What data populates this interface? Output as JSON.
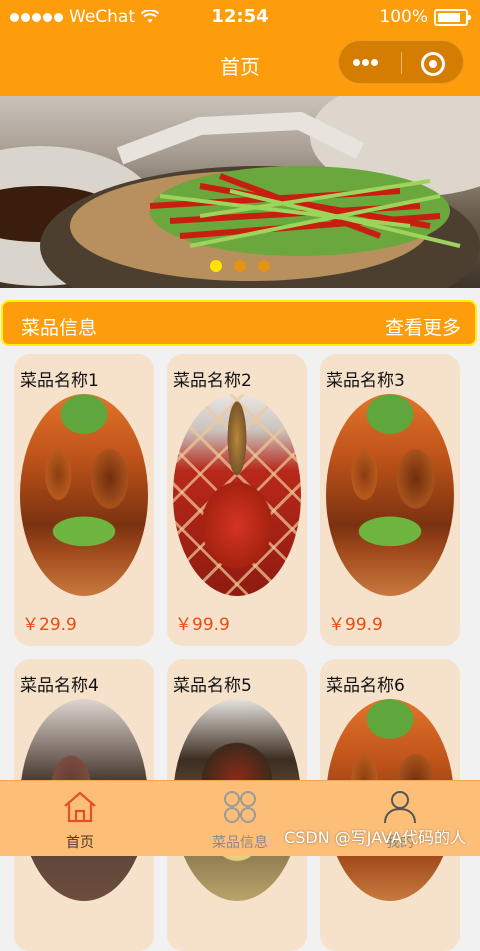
{
  "status_bar": {
    "carrier": "WeChat",
    "time": "12:54",
    "battery": "100%"
  },
  "nav_bar": {
    "title": "首页"
  },
  "banner": {
    "dot_count": 3,
    "active_index": 0
  },
  "section": {
    "title": "菜品信息",
    "more_label": "查看更多"
  },
  "dishes": [
    {
      "name": "菜品名称1",
      "price": "￥29.9",
      "image": "grilled-meat-platter"
    },
    {
      "name": "菜品名称2",
      "price": "￥99.9",
      "image": "spicy-hotpot"
    },
    {
      "name": "菜品名称3",
      "price": "￥99.9",
      "image": "grilled-meat-platter"
    },
    {
      "name": "菜品名称4",
      "price": "",
      "image": "braised-meat"
    },
    {
      "name": "菜品名称5",
      "price": "",
      "image": "rice-bowl"
    },
    {
      "name": "菜品名称6",
      "price": "",
      "image": "grilled-meat-platter"
    }
  ],
  "tab_bar": {
    "items": [
      {
        "label": "首页",
        "icon": "home-icon",
        "active": true
      },
      {
        "label": "菜品信息",
        "icon": "grid-icon",
        "active": false
      },
      {
        "label": "我的",
        "icon": "user-icon",
        "active": false
      }
    ]
  },
  "watermark": "CSDN @写JAVA代码的人",
  "colors": {
    "primary": "#fd9d0b",
    "highlight": "#fff200",
    "card": "#f6e1cb",
    "price": "#ea4b10",
    "tab_bar": "#fdbe78"
  }
}
